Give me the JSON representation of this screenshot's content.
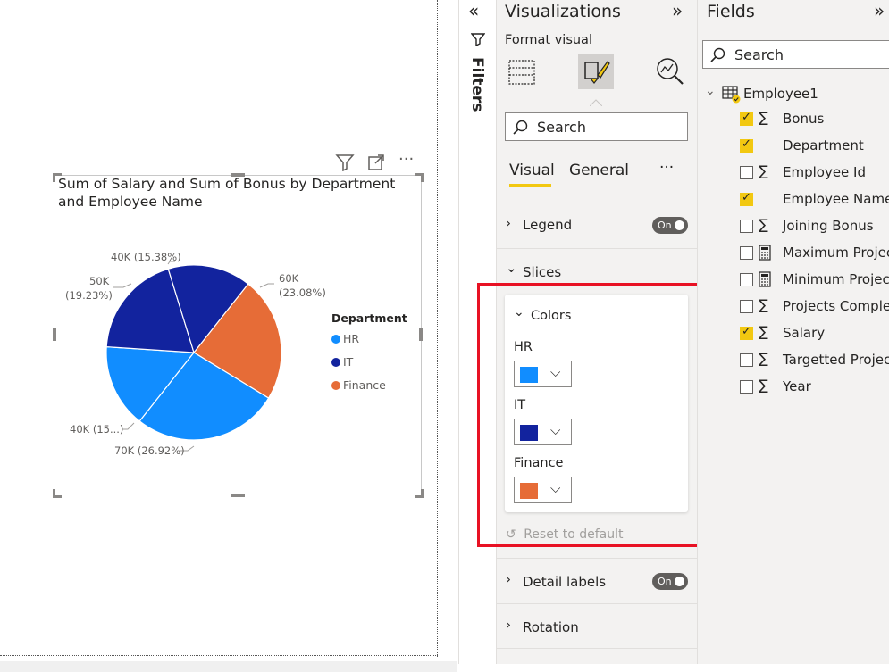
{
  "chart": {
    "title_line1": "Sum of Salary and Sum of Bonus by Department",
    "title_line2": "and Employee Name",
    "legend_title": "Department",
    "legend": [
      {
        "label": "HR",
        "color": "#118dff"
      },
      {
        "label": "IT",
        "color": "#12239e"
      },
      {
        "label": "Finance",
        "color": "#e66c37"
      }
    ],
    "slice_labels": {
      "top": "40K (15.38%)",
      "upper_left_1": "50K",
      "upper_left_2": "(19.23%)",
      "right_1": "60K",
      "right_2": "(23.08%)",
      "lower_left": "40K (15...)",
      "bottom": "70K (26.92%)"
    }
  },
  "chart_data": {
    "type": "pie",
    "title": "Sum of Salary and Sum of Bonus by Department and Employee Name",
    "legend_title": "Department",
    "legend_position": "right",
    "slices": [
      {
        "department": "Finance",
        "value": 60000,
        "percent": 23.08,
        "label": "60K (23.08%)",
        "color": "#e66c37"
      },
      {
        "department": "HR",
        "value": 70000,
        "percent": 26.92,
        "label": "70K (26.92%)",
        "color": "#118dff"
      },
      {
        "department": "HR",
        "value": 40000,
        "percent": 15.38,
        "label": "40K (15...)",
        "color": "#118dff"
      },
      {
        "department": "IT",
        "value": 50000,
        "percent": 19.23,
        "label": "50K (19.23%)",
        "color": "#12239e"
      },
      {
        "department": "IT",
        "value": 40000,
        "percent": 15.38,
        "label": "40K (15.38%)",
        "color": "#12239e"
      }
    ]
  },
  "filters": {
    "label": "Filters"
  },
  "visualizations": {
    "title": "Visualizations",
    "format_visual": "Format visual",
    "search_placeholder": "Search",
    "tabs": [
      "Visual",
      "General"
    ],
    "more": "···",
    "sections": {
      "legend": "Legend",
      "slices": "Slices",
      "colors": "Colors",
      "detail_labels": "Detail labels",
      "rotation": "Rotation"
    },
    "toggle_on": "On",
    "colors": [
      {
        "label": "HR",
        "hex": "#118dff"
      },
      {
        "label": "IT",
        "hex": "#12239e"
      },
      {
        "label": "Finance",
        "hex": "#e66c37"
      }
    ],
    "reset": "Reset to default"
  },
  "fields": {
    "title": "Fields",
    "search_placeholder": "Search",
    "table": "Employee1",
    "items": [
      {
        "name": "Bonus",
        "checked": true,
        "type": "sigma"
      },
      {
        "name": "Department",
        "checked": true,
        "type": "text"
      },
      {
        "name": "Employee Id",
        "checked": false,
        "type": "sigma"
      },
      {
        "name": "Employee Name",
        "checked": true,
        "type": "text"
      },
      {
        "name": "Joining Bonus",
        "checked": false,
        "type": "sigma"
      },
      {
        "name": "Maximum Projects",
        "checked": false,
        "type": "calc"
      },
      {
        "name": "Minimum Projects",
        "checked": false,
        "type": "calc"
      },
      {
        "name": "Projects Complet...",
        "checked": false,
        "type": "sigma"
      },
      {
        "name": "Salary",
        "checked": true,
        "type": "sigma"
      },
      {
        "name": "Targetted Projects",
        "checked": false,
        "type": "sigma"
      },
      {
        "name": "Year",
        "checked": false,
        "type": "sigma"
      }
    ]
  }
}
